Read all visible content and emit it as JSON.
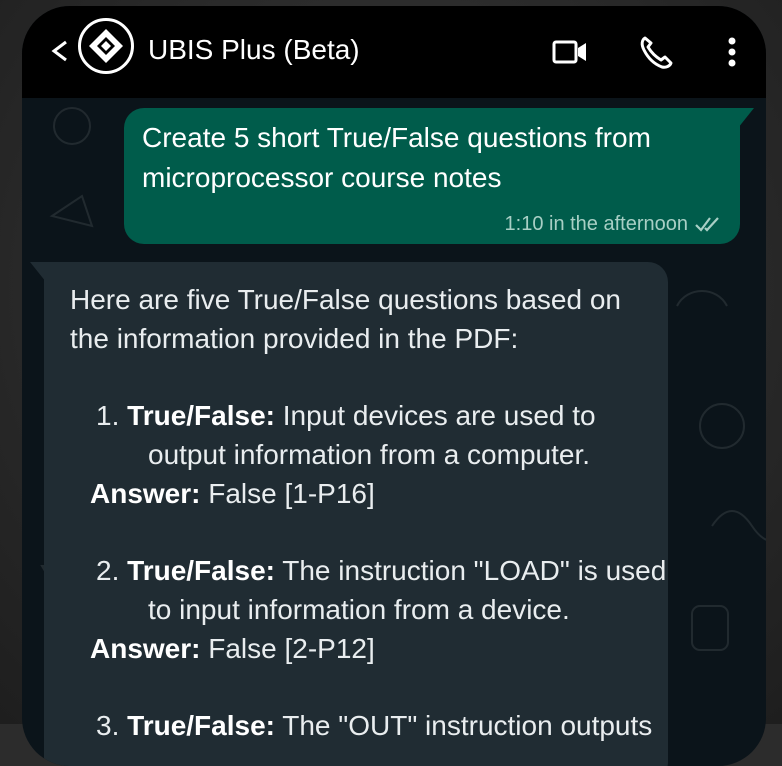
{
  "header": {
    "title": "UBIS Plus (Beta)"
  },
  "outgoing": {
    "lines": [
      "Create 5 short True/False questions from",
      "microprocessor course notes"
    ],
    "time": "1:10 in the afternoon"
  },
  "incoming": {
    "intro": [
      "Here are five True/False questions based on",
      "the information provided in the PDF:"
    ],
    "questions": [
      {
        "num": "1.",
        "label": "True/False:",
        "text1": " Input devices are used to",
        "text2": "output information from a computer.",
        "answer_label": "Answer:",
        "answer": " False [1-P16]"
      },
      {
        "num": "2.",
        "label": "True/False:",
        "text1": " The instruction \"LOAD\" is used",
        "text2": "to input information from a device.",
        "answer_label": "Answer:",
        "answer": " False [2-P12]"
      },
      {
        "num": "3.",
        "label": "True/False:",
        "text1": " The \"OUT\" instruction outputs"
      }
    ]
  }
}
